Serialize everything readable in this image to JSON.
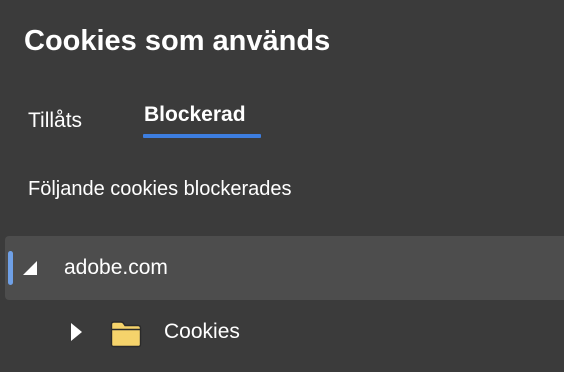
{
  "dialog": {
    "title": "Cookies som används"
  },
  "tabs": [
    {
      "label": "Tillåts",
      "selected": false
    },
    {
      "label": "Blockerad",
      "selected": true
    }
  ],
  "caption": "Följande cookies blockerades",
  "tree": {
    "domain": {
      "label": "adobe.com",
      "expanded": true,
      "selected": true,
      "icon": "triangle-expanded-icon"
    },
    "child": {
      "label": "Cookies",
      "expanded": false,
      "icon": "folder-icon",
      "expander_icon": "triangle-collapsed-icon"
    }
  },
  "colors": {
    "background": "#3b3b3b",
    "selected_row": "#4d4d4d",
    "accent": "#3d7ee0",
    "folder": "#f5d36b"
  }
}
